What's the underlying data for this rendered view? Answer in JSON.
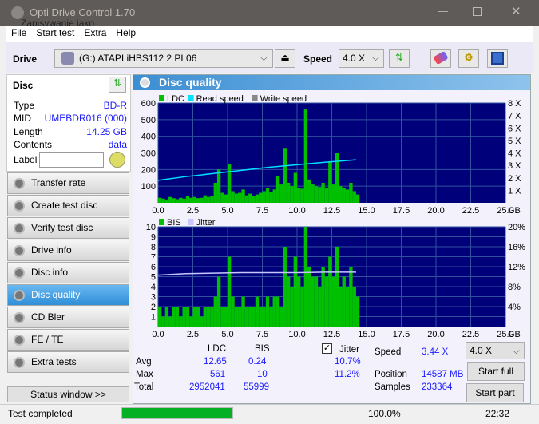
{
  "window": {
    "title": "Opti Drive Control 1.70",
    "overlay_text": "Zapisywanie jako"
  },
  "menu": [
    "File",
    "Start test",
    "Extra",
    "Help"
  ],
  "toolbar": {
    "drive_label": "Drive",
    "drive_value": "(G:)   ATAPI iHBS112   2 PL06",
    "speed_label": "Speed",
    "speed_value": "4.0 X"
  },
  "disc": {
    "title": "Disc",
    "fields": [
      {
        "k": "Type",
        "v": "BD-R"
      },
      {
        "k": "MID",
        "v": "UMEBDR016 (000)"
      },
      {
        "k": "Length",
        "v": "14.25 GB"
      },
      {
        "k": "Contents",
        "v": "data"
      }
    ],
    "label_label": "Label",
    "label_value": ""
  },
  "nav": [
    {
      "label": "Transfer rate"
    },
    {
      "label": "Create test disc"
    },
    {
      "label": "Verify test disc"
    },
    {
      "label": "Drive info"
    },
    {
      "label": "Disc info"
    },
    {
      "label": "Disc quality",
      "selected": true
    },
    {
      "label": "CD Bler"
    },
    {
      "label": "FE / TE"
    },
    {
      "label": "Extra tests"
    }
  ],
  "status_window": "Status window >>",
  "panel_title": "Disc quality",
  "colors": {
    "ldc": "#00c000",
    "bis": "#00c000",
    "read_speed": "#00e0ff",
    "jitter": "#c8c8ff",
    "plot_bg": "#00007a",
    "grid": "#3050a0",
    "accent": "#3c8ed3"
  },
  "chart_data": [
    {
      "type": "bar",
      "legend": [
        "LDC",
        "Read speed",
        "Write speed"
      ],
      "xlim": [
        0,
        25
      ],
      "ylim": [
        0,
        600
      ],
      "y2lim": [
        0,
        8
      ],
      "xticks": [
        "0.0",
        "2.5",
        "5.0",
        "7.5",
        "10.0",
        "12.5",
        "15.0",
        "17.5",
        "20.0",
        "22.5",
        "25.0"
      ],
      "xunit": "GB",
      "yticks": [
        "100",
        "200",
        "300",
        "400",
        "500",
        "600"
      ],
      "y2ticks": [
        "1 X",
        "2 X",
        "3 X",
        "4 X",
        "5 X",
        "6 X",
        "7 X",
        "8 X"
      ],
      "x_step": 0.25,
      "ldc": [
        30,
        25,
        20,
        35,
        28,
        22,
        30,
        25,
        40,
        30,
        35,
        28,
        30,
        45,
        35,
        40,
        120,
        200,
        60,
        50,
        230,
        70,
        55,
        60,
        80,
        45,
        55,
        40,
        50,
        60,
        70,
        90,
        65,
        80,
        160,
        110,
        330,
        120,
        100,
        180,
        90,
        85,
        561,
        140,
        110,
        100,
        95,
        120,
        90,
        250,
        110,
        300,
        100,
        90,
        80,
        120,
        70,
        50
      ],
      "read_speed": {
        "x": [
          0,
          2,
          4,
          6,
          8,
          10,
          12,
          14.25
        ],
        "y": [
          1.8,
          2.1,
          2.35,
          2.6,
          2.85,
          3.05,
          3.25,
          3.45
        ]
      }
    },
    {
      "type": "bar",
      "legend": [
        "BIS",
        "Jitter"
      ],
      "xlim": [
        0,
        25
      ],
      "ylim": [
        0,
        10
      ],
      "y2lim": [
        0,
        20
      ],
      "xticks": [
        "0.0",
        "2.5",
        "5.0",
        "7.5",
        "10.0",
        "12.5",
        "15.0",
        "17.5",
        "20.0",
        "22.5",
        "25.0"
      ],
      "xunit": "GB",
      "yticks": [
        "1",
        "2",
        "3",
        "4",
        "5",
        "6",
        "7",
        "8",
        "9",
        "10"
      ],
      "y2ticks": [
        "4%",
        "8%",
        "12%",
        "16%",
        "20%"
      ],
      "x_step": 0.25,
      "bis": [
        2,
        1,
        2,
        1,
        2,
        2,
        1,
        2,
        2,
        1,
        2,
        2,
        1,
        2,
        2,
        2,
        3,
        5,
        2,
        2,
        7,
        3,
        2,
        2,
        3,
        2,
        2,
        2,
        3,
        2,
        2,
        3,
        2,
        3,
        3,
        2,
        8,
        5,
        4,
        7,
        5,
        4,
        10,
        6,
        5,
        5,
        4,
        6,
        5,
        7,
        5,
        8,
        4,
        5,
        4,
        6,
        4,
        3
      ],
      "jitter": {
        "x": [
          0,
          2,
          4,
          6,
          8,
          10,
          12,
          14.25
        ],
        "y": [
          10.3,
          10.6,
          10.7,
          10.8,
          10.8,
          10.8,
          10.9,
          10.9
        ]
      }
    }
  ],
  "stats": {
    "col_ldc": "LDC",
    "col_bis": "BIS",
    "jitter_label": "Jitter",
    "jitter_checked": true,
    "avg_label": "Avg",
    "avg_ldc": "12.65",
    "avg_bis": "0.24",
    "avg_jitter": "10.7%",
    "max_label": "Max",
    "max_ldc": "561",
    "max_bis": "10",
    "max_jitter": "11.2%",
    "total_label": "Total",
    "total_ldc": "2952041",
    "total_bis": "55999",
    "speed_label": "Speed",
    "speed_value": "3.44 X",
    "position_label": "Position",
    "position_value": "14587 MB",
    "samples_label": "Samples",
    "samples_value": "233364",
    "speed_select": "4.0 X",
    "start_full": "Start full",
    "start_part": "Start part"
  },
  "status": {
    "text": "Test completed",
    "progress": 100,
    "progress_text": "100.0%",
    "time": "22:32"
  }
}
